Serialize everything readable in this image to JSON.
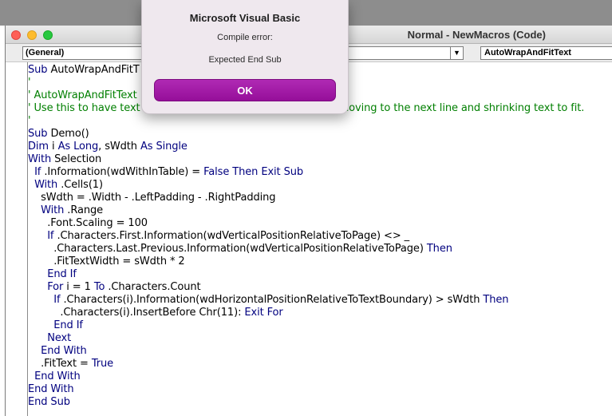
{
  "window": {
    "title": "Normal - NewMacros (Code)",
    "object_combo": "(General)",
    "procedure_combo": "AutoWrapAndFitText"
  },
  "dialog": {
    "title": "Microsoft Visual Basic",
    "message_line1": "Compile error:",
    "message_line2": "Expected End Sub",
    "ok_label": "OK"
  },
  "colors": {
    "keyword": "#00007f",
    "comment": "#007f00",
    "ok_button": "#a51fa9"
  },
  "code_lines": [
    [
      [
        "Sub ",
        "kw"
      ],
      [
        "AutoWrapAndFitT",
        ""
      ]
    ],
    [
      [
        "'",
        "cm"
      ]
    ],
    [
      [
        "' AutoWrapAndFitText",
        "cm"
      ]
    ],
    [
      [
        "' Use this to have text",
        "cm"
      ],
      [
        "                                                          ly moving to the next line and shrinking text to fit.",
        "cm"
      ]
    ],
    [
      [
        "'",
        "cm"
      ]
    ],
    [
      [
        "Sub ",
        "kw"
      ],
      [
        "Demo()",
        ""
      ]
    ],
    [
      [
        "Dim ",
        "kw"
      ],
      [
        "i ",
        ""
      ],
      [
        "As Long",
        "kw"
      ],
      [
        ", sWdth ",
        ""
      ],
      [
        "As Single",
        "kw"
      ]
    ],
    [
      [
        "With ",
        "kw"
      ],
      [
        "Selection",
        ""
      ]
    ],
    [
      [
        "  ",
        ""
      ],
      [
        "If ",
        "kw"
      ],
      [
        ".Information(wdWithInTable) = ",
        ""
      ],
      [
        "False Then Exit Sub",
        "kw"
      ]
    ],
    [
      [
        "  ",
        ""
      ],
      [
        "With ",
        "kw"
      ],
      [
        ".Cells(1)",
        ""
      ]
    ],
    [
      [
        "    sWdth = .Width - .LeftPadding - .RightPadding",
        ""
      ]
    ],
    [
      [
        "    ",
        ""
      ],
      [
        "With ",
        "kw"
      ],
      [
        ".Range",
        ""
      ]
    ],
    [
      [
        "      .Font.Scaling = 100",
        ""
      ]
    ],
    [
      [
        "      ",
        ""
      ],
      [
        "If ",
        "kw"
      ],
      [
        ".Characters.First.Information(wdVerticalPositionRelativeToPage) <> _",
        ""
      ]
    ],
    [
      [
        "        .Characters.Last.Previous.Information(wdVerticalPositionRelativeToPage) ",
        ""
      ],
      [
        "Then",
        "kw"
      ]
    ],
    [
      [
        "        .FitTextWidth = sWdth * 2",
        ""
      ]
    ],
    [
      [
        "      ",
        ""
      ],
      [
        "End If",
        "kw"
      ]
    ],
    [
      [
        "      ",
        ""
      ],
      [
        "For ",
        "kw"
      ],
      [
        "i = 1 ",
        ""
      ],
      [
        "To ",
        "kw"
      ],
      [
        ".Characters.Count",
        ""
      ]
    ],
    [
      [
        "        ",
        ""
      ],
      [
        "If ",
        "kw"
      ],
      [
        ".Characters(i).Information(wdHorizontalPositionRelativeToTextBoundary) > sWdth ",
        ""
      ],
      [
        "Then",
        "kw"
      ]
    ],
    [
      [
        "          .Characters(i).InsertBefore Chr(11): ",
        ""
      ],
      [
        "Exit For",
        "kw"
      ]
    ],
    [
      [
        "        ",
        ""
      ],
      [
        "End If",
        "kw"
      ]
    ],
    [
      [
        "      ",
        ""
      ],
      [
        "Next",
        "kw"
      ]
    ],
    [
      [
        "    ",
        ""
      ],
      [
        "End With",
        "kw"
      ]
    ],
    [
      [
        "    .FitText = ",
        ""
      ],
      [
        "True",
        "kw"
      ]
    ],
    [
      [
        "  ",
        ""
      ],
      [
        "End With",
        "kw"
      ]
    ],
    [
      [
        "End With",
        "kw"
      ]
    ],
    [
      [
        "End Sub",
        "kw"
      ]
    ]
  ]
}
